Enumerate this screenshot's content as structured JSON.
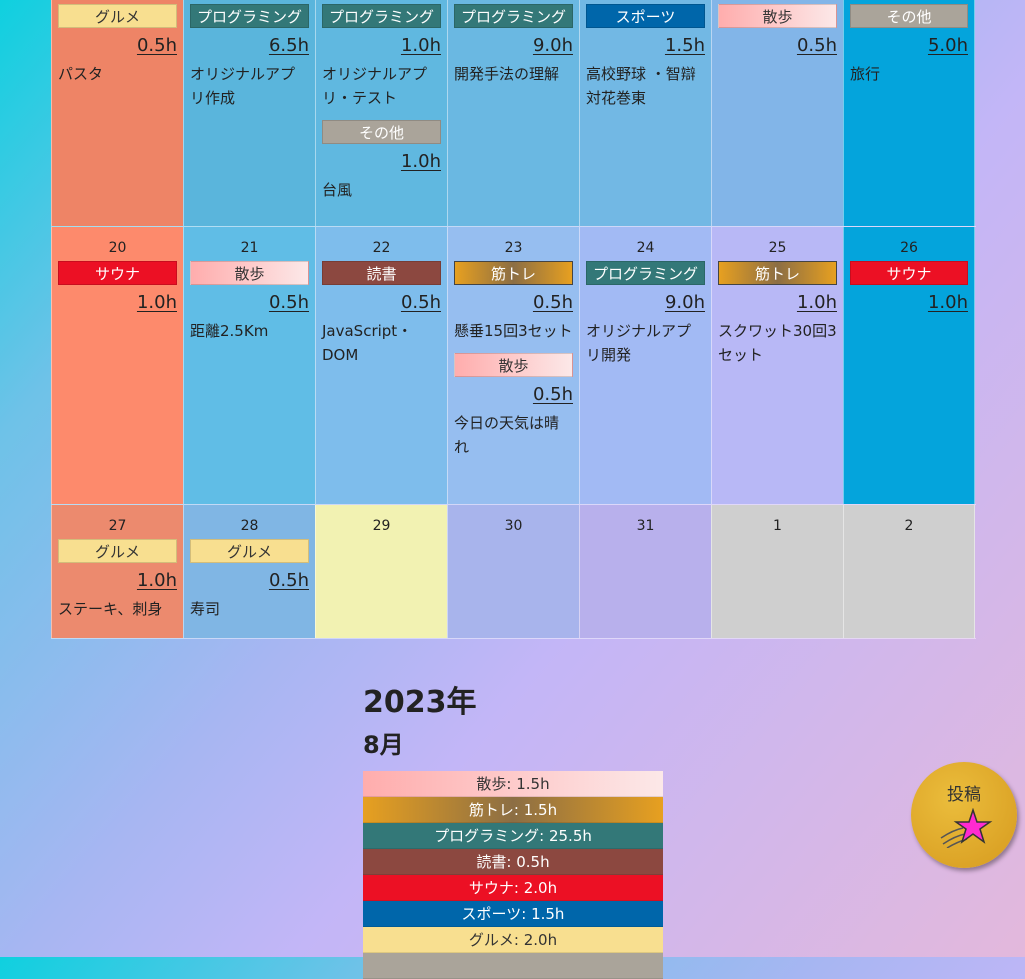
{
  "calendar": {
    "weeks": [
      {
        "days": [
          {
            "num": "",
            "color": "#ee8466",
            "entries": [
              {
                "label": "グルメ",
                "cat": "gourmet",
                "hours": "0.5h",
                "memo": "パスタ"
              }
            ]
          },
          {
            "num": "",
            "color": "#5ab5dc",
            "entries": [
              {
                "label": "プログラミング",
                "cat": "prog",
                "hours": "6.5h",
                "memo": "オリジナルアプリ作成"
              }
            ]
          },
          {
            "num": "",
            "color": "#60b8e0",
            "entries": [
              {
                "label": "プログラミング",
                "cat": "prog",
                "hours": "1.0h",
                "memo": "オリジナルアプリ・テスト"
              },
              {
                "label": "その他",
                "cat": "other",
                "hours": "1.0h",
                "memo": "台風"
              }
            ]
          },
          {
            "num": "",
            "color": "#6ab8e2",
            "entries": [
              {
                "label": "プログラミング",
                "cat": "prog",
                "hours": "9.0h",
                "memo": "開発手法の理解"
              }
            ]
          },
          {
            "num": "",
            "color": "#72b8e4",
            "entries": [
              {
                "label": "スポーツ",
                "cat": "sports",
                "hours": "1.5h",
                "memo": "高校野球 ・智辯対花巻東"
              }
            ]
          },
          {
            "num": "",
            "color": "#82b5e8",
            "entries": [
              {
                "label": "散歩",
                "cat": "walk",
                "hours": "0.5h",
                "memo": ""
              }
            ]
          },
          {
            "num": "",
            "color": "#04a4dc",
            "entries": [
              {
                "label": "その他",
                "cat": "other",
                "hours": "5.0h",
                "memo": "旅行"
              }
            ]
          }
        ]
      },
      {
        "days": [
          {
            "num": "20",
            "color": "#fd8a6c",
            "entries": [
              {
                "label": "サウナ",
                "cat": "sauna",
                "hours": "1.0h",
                "memo": ""
              }
            ]
          },
          {
            "num": "21",
            "color": "#60bde6",
            "entries": [
              {
                "label": "散歩",
                "cat": "walk",
                "hours": "0.5h",
                "memo": "距離2.5Km"
              }
            ]
          },
          {
            "num": "22",
            "color": "#7ebdec",
            "entries": [
              {
                "label": "読書",
                "cat": "read",
                "hours": "0.5h",
                "memo": "JavaScript・DOM"
              }
            ]
          },
          {
            "num": "23",
            "color": "#96bef0",
            "entries": [
              {
                "label": "筋トレ",
                "cat": "muscle",
                "hours": "0.5h",
                "memo": "懸垂15回3セット"
              },
              {
                "label": "散歩",
                "cat": "walk",
                "hours": "0.5h",
                "memo": "今日の天気は晴れ"
              }
            ]
          },
          {
            "num": "24",
            "color": "#a2baf4",
            "entries": [
              {
                "label": "プログラミング",
                "cat": "prog",
                "hours": "9.0h",
                "memo": "オリジナルアプリ開発"
              }
            ]
          },
          {
            "num": "25",
            "color": "#b8b8f6",
            "entries": [
              {
                "label": "筋トレ",
                "cat": "muscle",
                "hours": "1.0h",
                "memo": "スクワット30回3セット"
              }
            ]
          },
          {
            "num": "26",
            "color": "#04a4dc",
            "entries": [
              {
                "label": "サウナ",
                "cat": "sauna",
                "hours": "1.0h",
                "memo": ""
              }
            ]
          }
        ]
      },
      {
        "days": [
          {
            "num": "27",
            "color": "#ec8a6e",
            "entries": [
              {
                "label": "グルメ",
                "cat": "gourmet",
                "hours": "1.0h",
                "memo": "ステーキ、刺身"
              }
            ]
          },
          {
            "num": "28",
            "color": "#80b6e4",
            "entries": [
              {
                "label": "グルメ",
                "cat": "gourmet",
                "hours": "0.5h",
                "memo": "寿司"
              }
            ]
          },
          {
            "num": "29",
            "color": "#f2f2b2",
            "entries": []
          },
          {
            "num": "30",
            "color": "#a8b4ec",
            "entries": []
          },
          {
            "num": "31",
            "color": "#b8b0ec",
            "entries": []
          },
          {
            "num": "1",
            "color": "#cfcfcf",
            "entries": []
          },
          {
            "num": "2",
            "color": "#cfcfcf",
            "entries": []
          }
        ]
      }
    ]
  },
  "summary": {
    "year": "2023年",
    "month": "8月",
    "rows": [
      {
        "label": "散歩",
        "value": ": 1.5h",
        "cat": "walk"
      },
      {
        "label": "筋トレ",
        "value": ": 1.5h",
        "cat": "muscle"
      },
      {
        "label": "プログラミング",
        "value": ": 25.5h",
        "cat": "prog"
      },
      {
        "label": "読書",
        "value": ": 0.5h",
        "cat": "read"
      },
      {
        "label": "サウナ",
        "value": ": 2.0h",
        "cat": "sauna"
      },
      {
        "label": "スポーツ",
        "value": ": 1.5h",
        "cat": "sports"
      },
      {
        "label": "グルメ",
        "value": ": 2.0h",
        "cat": "gourmet"
      },
      {
        "label": "",
        "value": "",
        "cat": "other"
      }
    ]
  },
  "post_button": {
    "label": "投稿",
    "icon": "shooting-star-icon"
  }
}
